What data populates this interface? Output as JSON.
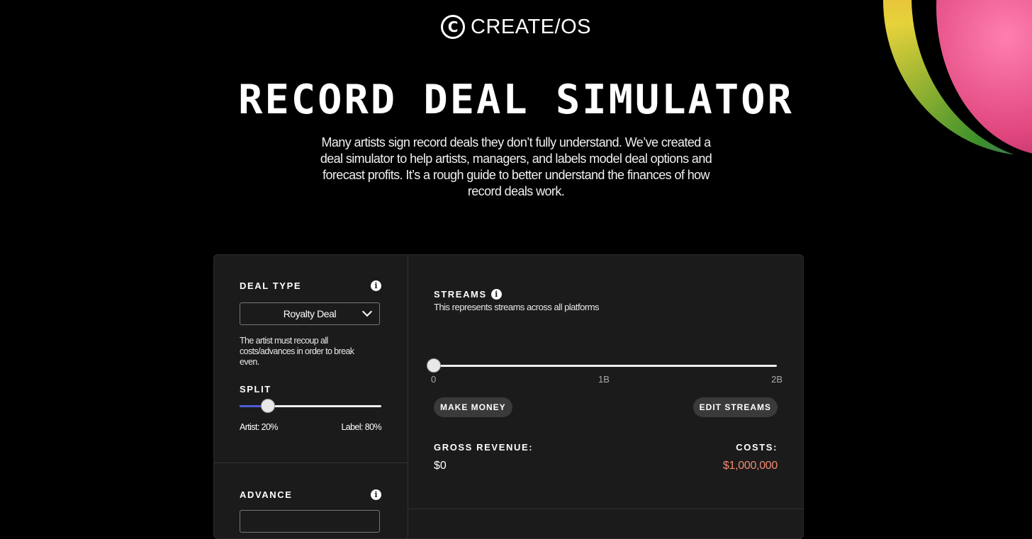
{
  "brand": {
    "mark": "C",
    "name": "CREATE/OS"
  },
  "hero": {
    "title": "RECORD DEAL SIMULATOR",
    "intro": "Many artists sign record deals they don’t fully understand. We’ve created a deal simulator to help artists, managers, and labels model deal options and forecast profits. It’s a rough guide to better understand the finances of how record deals work."
  },
  "deal": {
    "label": "DEAL TYPE",
    "info_icon": "i",
    "selected": "Royalty Deal",
    "description": "The artist must recoup all costs/advances in order to break even."
  },
  "split": {
    "label": "SPLIT",
    "artist_text": "Artist: 20%",
    "label_text": "Label: 80%",
    "artist_fraction": 0.2
  },
  "advance": {
    "label": "ADVANCE",
    "info_icon": "i"
  },
  "streams": {
    "label": "STREAMS",
    "info_icon": "i",
    "subtitle": "This represents streams across all platforms",
    "ticks": [
      "0",
      "1B",
      "2B"
    ],
    "value_fraction": 0.0
  },
  "buttons": {
    "make_money": "MAKE MONEY",
    "edit_streams": "EDIT STREAMS"
  },
  "summary": {
    "gross_label": "GROSS REVENUE:",
    "gross_value": "$0",
    "costs_label": "COSTS:",
    "costs_value": "$1,000,000"
  },
  "colors": {
    "accent": "#4f5cd8",
    "costs": "#f08a70",
    "card": "#1b1b1b"
  }
}
